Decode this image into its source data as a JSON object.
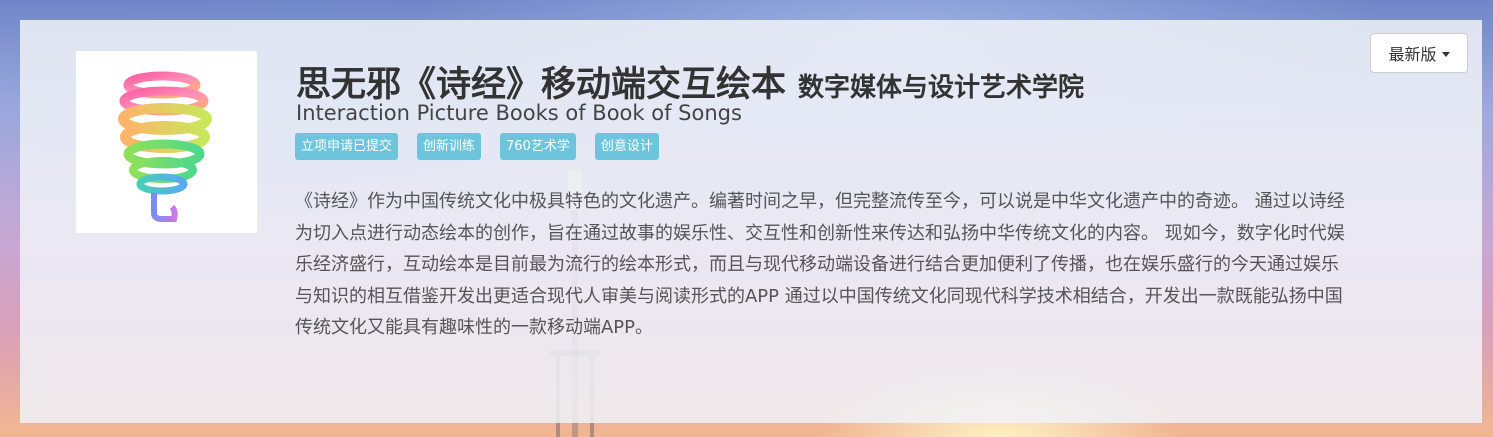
{
  "project": {
    "title": "思无邪《诗经》移动端交互绘本",
    "college": "数字媒体与设计艺术学院",
    "title_en": "Interaction Picture Books of Book of Songs",
    "tags": [
      "立项申请已提交",
      "创新训练",
      "760艺术学",
      "创意设计"
    ],
    "description": "《诗经》作为中国传统文化中极具特色的文化遗产。编著时间之早，但完整流传至今，可以说是中华文化遗产中的奇迹。 通过以诗经为切入点进行动态绘本的创作，旨在通过故事的娱乐性、交互性和创新性来传达和弘扬中华传统文化的内容。 现如今，数字化时代娱乐经济盛行，互动绘本是目前最为流行的绘本形式，而且与现代移动端设备进行结合更加便利了传播，也在娱乐盛行的今天通过娱乐与知识的相互借鉴开发出更适合现代人审美与阅读形式的APP 通过以中国传统文化同现代科学技术相结合，开发出一款既能弘扬中国传统文化又能具有趣味性的一款移动端APP。"
  },
  "version_dropdown": {
    "label": "最新版",
    "icon": "caret-down-icon"
  },
  "logo": {
    "icon": "spiral-balloon-logo"
  },
  "colors": {
    "tag_bg": "#6cc5dc",
    "panel_bg": "#f0f2f8",
    "title": "#333333"
  }
}
